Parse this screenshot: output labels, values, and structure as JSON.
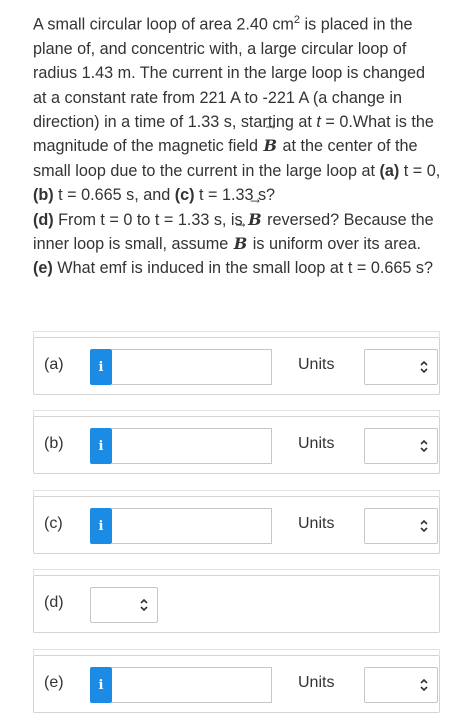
{
  "question": {
    "p1": "A small circular loop of area 2.40 cm",
    "sup": "2",
    "p2": " is placed in the plane of, and concentric with, a large circular loop of radius 1.43 m. The current in the large loop is changed at a constant rate from 221 A to -221 A (a change in direction) in a time of 1.33 s, starting at ",
    "t": "t",
    "p3": " = 0.What is the magnitude of the magnetic field ",
    "B": "B",
    "p4": " at the center of the small loop due to the current in the large loop at ",
    "a": "(a)",
    "p5": " t = 0, ",
    "b": "(b)",
    "p6": " t = 0.665 s, and ",
    "c": "(c)",
    "p7": " t = 1.33 s? ",
    "d": "(d)",
    "p8": " From t = 0 to t = 1.33 s, is ",
    "p9": " reversed? Because the inner loop is small, assume ",
    "p10": " is uniform over its area. ",
    "e": "(e)",
    "p11": " What emf is induced in the small loop at t = 0.665 s?"
  },
  "parts": [
    {
      "label": "(a)",
      "value": "",
      "units_label": "Units",
      "units_value": ""
    },
    {
      "label": "(b)",
      "value": "",
      "units_label": "Units",
      "units_value": ""
    },
    {
      "label": "(c)",
      "value": "",
      "units_label": "Units",
      "units_value": ""
    },
    {
      "label": "(d)",
      "select_value": ""
    },
    {
      "label": "(e)",
      "value": "",
      "units_label": "Units",
      "units_value": ""
    }
  ],
  "info_glyph": "i",
  "icons": {
    "info": "info-icon",
    "dropdown": "chevron-updown-icon"
  },
  "colors": {
    "info_button": "#1b8be6",
    "border": "#c7c7c7"
  }
}
